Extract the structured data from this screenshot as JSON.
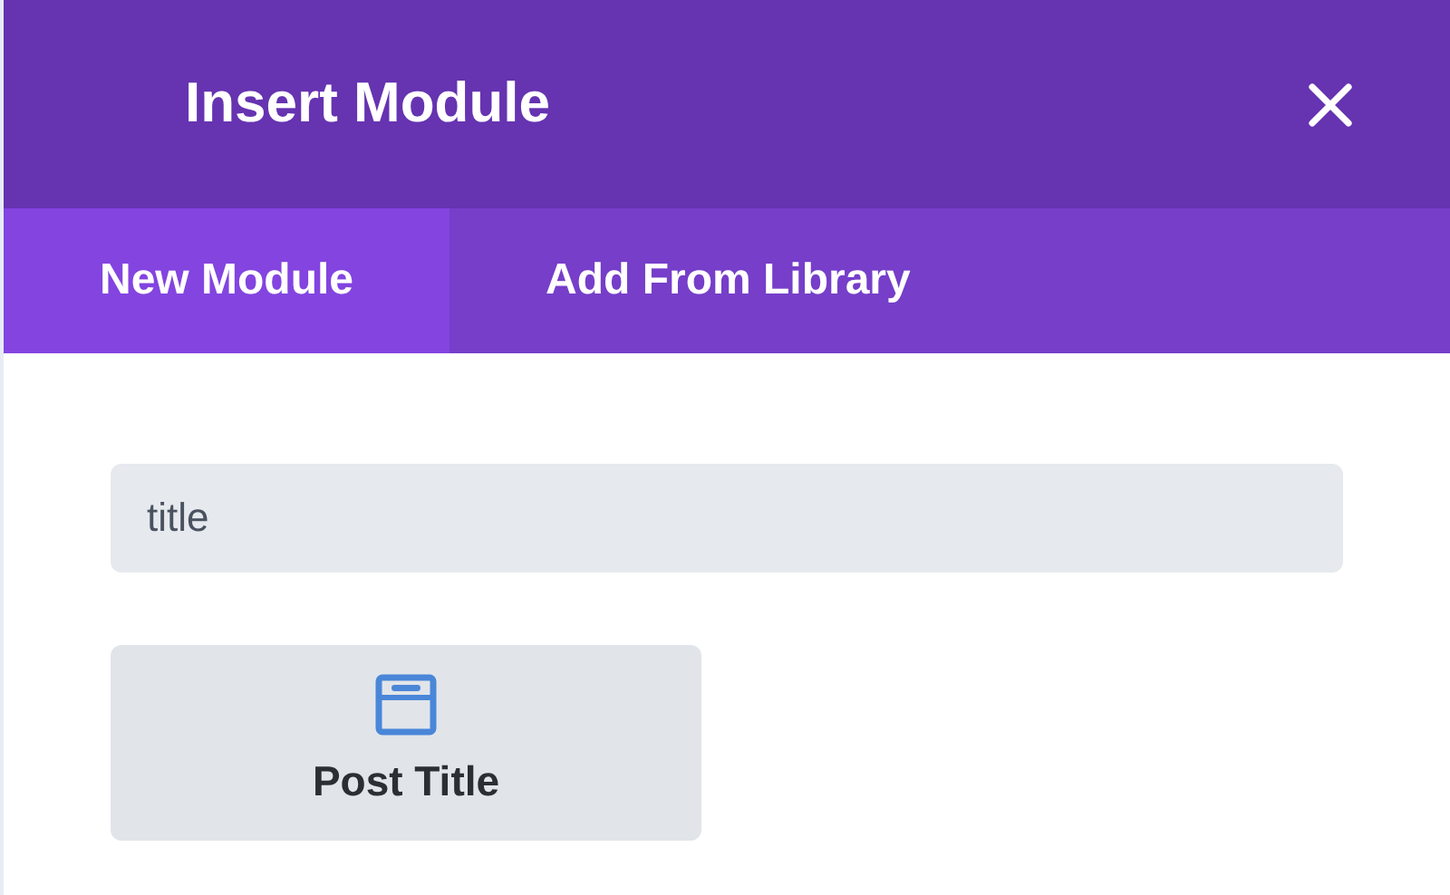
{
  "window": {
    "title": "Insert Module"
  },
  "tabs": [
    {
      "label": "New Module",
      "selected": true
    },
    {
      "label": "Add From Library",
      "selected": false
    }
  ],
  "search": {
    "value": "title"
  },
  "modules": [
    {
      "label": "Post Title"
    }
  ]
}
